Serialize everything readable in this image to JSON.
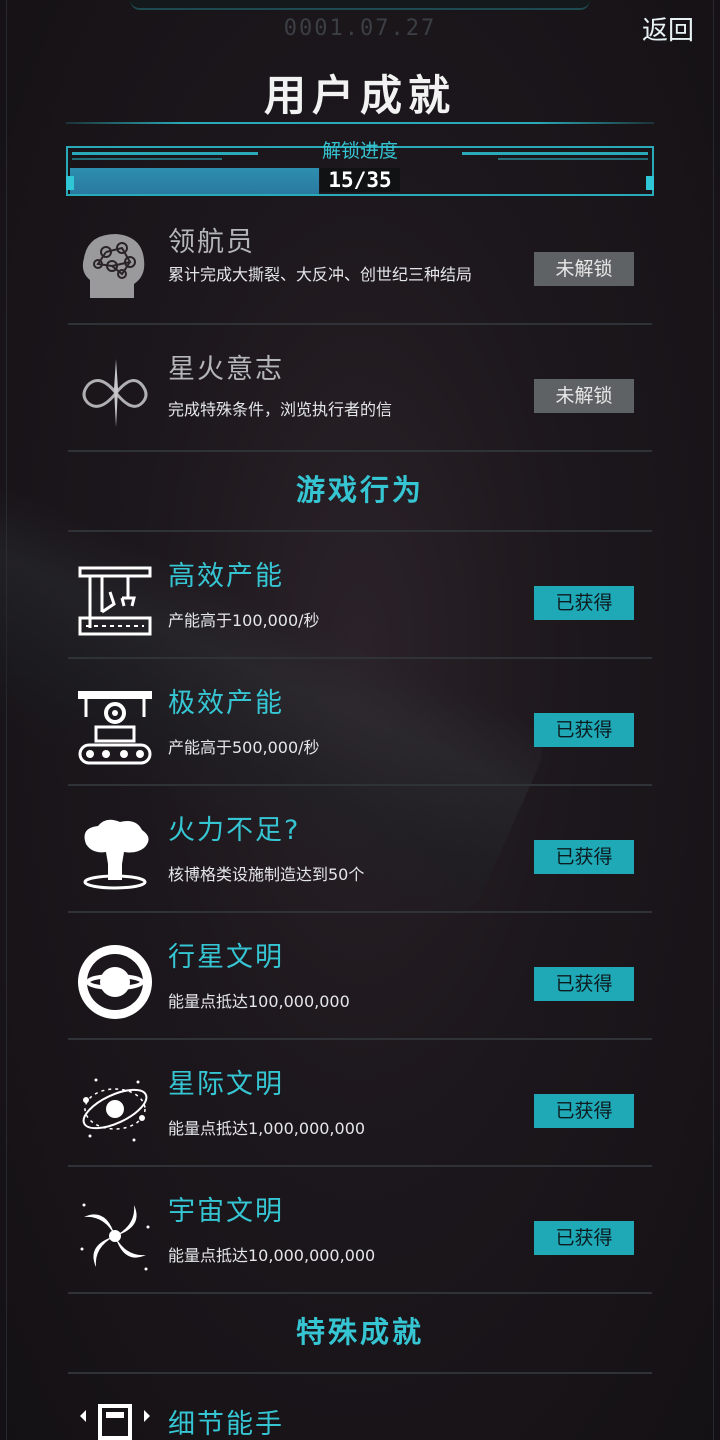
{
  "header": {
    "date": "0001.07.27",
    "back_label": "返回",
    "title": "用户成就"
  },
  "progress": {
    "label": "解锁进度",
    "text": "15/35",
    "unlocked": 15,
    "total": 35
  },
  "achievements": [
    {
      "icon": "brain-head-icon",
      "name": "领航员",
      "desc": "累计完成大撕裂、大反冲、创世纪三种结局",
      "status": "未解锁",
      "state": "locked"
    },
    {
      "icon": "infinity-star-icon",
      "name": "星火意志",
      "desc": "完成特殊条件，浏览执行者的信",
      "status": "未解锁",
      "state": "locked"
    }
  ],
  "sections": {
    "game_behavior": "游戏行为",
    "special": "特殊成就"
  },
  "behavior_achievements": [
    {
      "icon": "robot-arm-factory-icon",
      "name": "高效产能",
      "desc": "产能高于100,000/秒",
      "status": "已获得",
      "state": "earned"
    },
    {
      "icon": "conveyor-gear-icon",
      "name": "极效产能",
      "desc": "产能高于500,000/秒",
      "status": "已获得",
      "state": "earned"
    },
    {
      "icon": "mushroom-cloud-icon",
      "name": "火力不足?",
      "desc": "核博格类设施制造达到50个",
      "status": "已获得",
      "state": "earned"
    },
    {
      "icon": "planet-ring-icon",
      "name": "行星文明",
      "desc": "能量点抵达100,000,000",
      "status": "已获得",
      "state": "earned"
    },
    {
      "icon": "star-orbit-icon",
      "name": "星际文明",
      "desc": "能量点抵达1,000,000,000",
      "status": "已获得",
      "state": "earned"
    },
    {
      "icon": "galaxy-swirl-icon",
      "name": "宇宙文明",
      "desc": "能量点抵达10,000,000,000",
      "status": "已获得",
      "state": "earned"
    }
  ],
  "special_partial": {
    "icon": "device-icon",
    "name": "细节能手"
  },
  "colors": {
    "accent": "#36c5d3",
    "badge_earned": "#1fa8b6",
    "badge_locked": "#5f6264",
    "background": "#1c171c"
  }
}
